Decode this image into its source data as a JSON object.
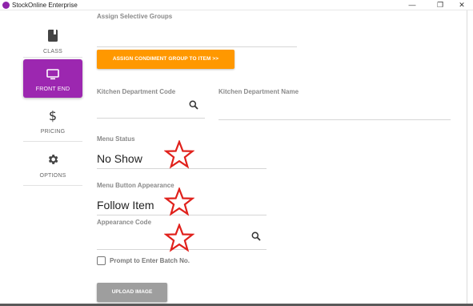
{
  "window": {
    "title": "StockOnline Enterprise",
    "minimize_glyph": "—",
    "restore_glyph": "❐",
    "close_glyph": "✕"
  },
  "sidebar": {
    "items": [
      {
        "label": "CLASS",
        "icon": "book-icon",
        "active": false
      },
      {
        "label": "FRONT END",
        "icon": "monitor-icon",
        "active": true
      },
      {
        "label": "PRICING",
        "icon": "dollar-icon",
        "active": false
      },
      {
        "label": "OPTIONS",
        "icon": "gear-icon",
        "active": false
      }
    ],
    "dollar_glyph": "$"
  },
  "main": {
    "assign_groups_label": "Assign Selective Groups",
    "assign_condiment_button": "ASSIGN CONDIMENT GROUP TO ITEM >>",
    "kitchen_dept_code_label": "Kitchen Department Code",
    "kitchen_dept_code_value": "",
    "kitchen_dept_name_label": "Kitchen Department Name",
    "kitchen_dept_name_value": "",
    "menu_status_label": "Menu Status",
    "menu_status_value": "No Show",
    "menu_button_appearance_label": "Menu Button Appearance",
    "menu_button_appearance_value": "Follow Item",
    "appearance_code_label": "Appearance Code",
    "appearance_code_value": "",
    "prompt_batch_label": "Prompt to Enter Batch No.",
    "prompt_batch_checked": false,
    "upload_image_button": "UPLOAD IMAGE"
  },
  "colors": {
    "active_nav": "#9c27b0",
    "orange_button": "#ff9800",
    "gray_button": "#9e9e9e",
    "star_annotation": "#e0201b"
  }
}
